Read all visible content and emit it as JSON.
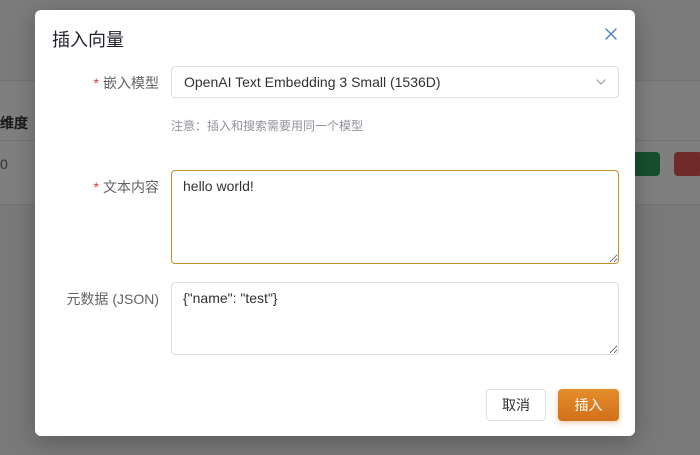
{
  "background": {
    "column_header": "维度",
    "cell_value": "0"
  },
  "dialog": {
    "title": "插入向量",
    "close_icon": "close-icon",
    "fields": {
      "model": {
        "label": "嵌入模型",
        "required": true,
        "value": "OpenAI Text Embedding 3 Small (1536D)",
        "hint": "注意：插入和搜索需要用同一个模型"
      },
      "content": {
        "label": "文本内容",
        "required": true,
        "value": "hello world!"
      },
      "metadata": {
        "label": "元数据 (JSON)",
        "required": false,
        "value": "{\"name\": \"test\"}"
      }
    },
    "buttons": {
      "cancel": "取消",
      "insert": "插入"
    }
  },
  "colors": {
    "accent": "#d87a1f",
    "required": "#e03a3a",
    "focused_border": "#c28f2c"
  }
}
